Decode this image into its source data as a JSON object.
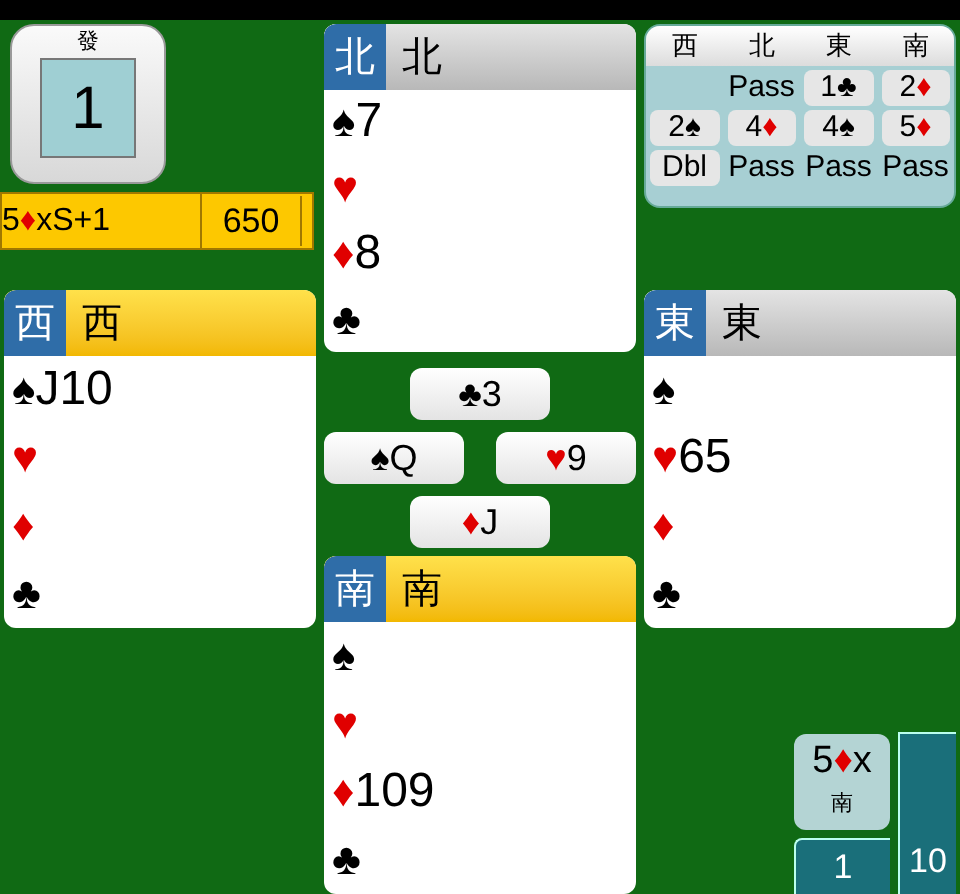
{
  "board": {
    "dealer": "發",
    "number": "1"
  },
  "result": {
    "level": "5",
    "color": "#e00000",
    "symbol": "♦",
    "suffix": "xS+1",
    "score": "650"
  },
  "hands": [
    {
      "seat": "北",
      "name": "北",
      "highlighted": false,
      "suits": [
        {
          "color": "#000000",
          "symbol": "♠",
          "cards": "7"
        },
        {
          "color": "#e00000",
          "symbol": "♥"
        },
        {
          "color": "#e00000",
          "symbol": "♦",
          "cards": "8"
        },
        {
          "color": "#000000",
          "symbol": "♣"
        }
      ]
    },
    {
      "seat": "西",
      "name": "西",
      "highlighted": true,
      "suits": [
        {
          "color": "#000000",
          "symbol": "♠",
          "cards": "J10"
        },
        {
          "color": "#e00000",
          "symbol": "♥"
        },
        {
          "color": "#e00000",
          "symbol": "♦"
        },
        {
          "color": "#000000",
          "symbol": "♣"
        }
      ]
    },
    {
      "seat": "東",
      "name": "東",
      "highlighted": false,
      "suits": [
        {
          "color": "#000000",
          "symbol": "♠"
        },
        {
          "color": "#e00000",
          "symbol": "♥",
          "cards": "65"
        },
        {
          "color": "#e00000",
          "symbol": "♦"
        },
        {
          "color": "#000000",
          "symbol": "♣"
        }
      ]
    },
    {
      "seat": "南",
      "name": "南",
      "highlighted": true,
      "suits": [
        {
          "color": "#000000",
          "symbol": "♠"
        },
        {
          "color": "#e00000",
          "symbol": "♥"
        },
        {
          "color": "#e00000",
          "symbol": "♦",
          "cards": "109"
        },
        {
          "color": "#000000",
          "symbol": "♣"
        }
      ]
    }
  ],
  "trick": [
    {
      "color": "#000000",
      "symbol": "♣",
      "rank": "3"
    },
    {
      "color": "#000000",
      "symbol": "♠",
      "rank": "Q"
    },
    {
      "color": "#e00000",
      "symbol": "♥",
      "rank": "9"
    },
    {
      "color": "#e00000",
      "symbol": "♦",
      "rank": "J"
    }
  ],
  "bidding": {
    "columns": [
      "西",
      "北",
      "東",
      "南"
    ],
    "rows": [
      [
        null,
        {
          "kind": "plain",
          "text": "Pass"
        },
        {
          "kind": "bid",
          "level": "1",
          "color": "#000000",
          "symbol": "♣"
        },
        {
          "kind": "bid",
          "level": "2",
          "color": "#e00000",
          "symbol": "♦"
        }
      ],
      [
        {
          "kind": "bid",
          "level": "2",
          "color": "#000000",
          "symbol": "♠"
        },
        {
          "kind": "bid",
          "level": "4",
          "color": "#e00000",
          "symbol": "♦"
        },
        {
          "kind": "bid",
          "level": "4",
          "color": "#000000",
          "symbol": "♠"
        },
        {
          "kind": "bid",
          "level": "5",
          "color": "#e00000",
          "symbol": "♦"
        }
      ],
      [
        {
          "kind": "call",
          "text": "Dbl"
        },
        {
          "kind": "plain",
          "text": "Pass"
        },
        {
          "kind": "plain",
          "text": "Pass"
        },
        {
          "kind": "plain",
          "text": "Pass"
        }
      ]
    ]
  },
  "contract": {
    "level": "5",
    "color": "#e00000",
    "symbol": "♦",
    "double": "x",
    "declarer": "南"
  },
  "tricks": {
    "ours": "1",
    "theirs": "10"
  }
}
